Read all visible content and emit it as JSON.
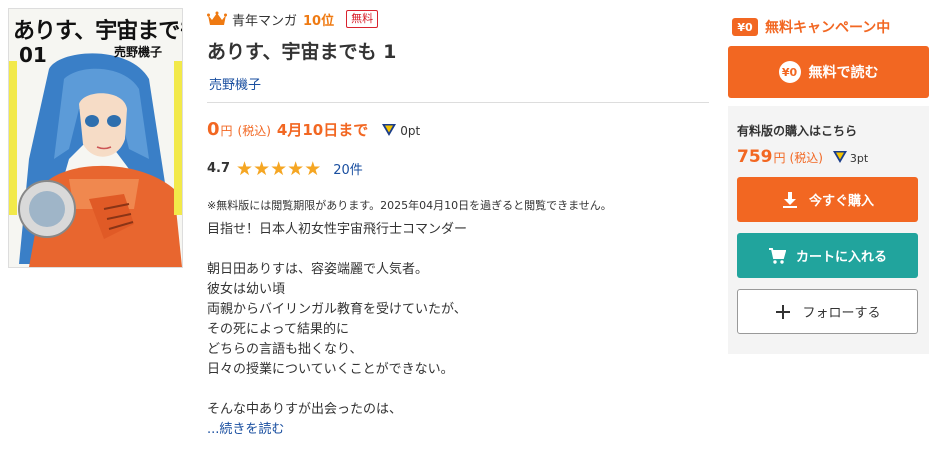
{
  "cover": {
    "title_text": "ありす、宇宙までも",
    "volume_text": "01",
    "author_text": "売野機子"
  },
  "header": {
    "genre": "青年マンガ",
    "rank": "10位",
    "free_badge": "無料"
  },
  "book": {
    "title": "ありす、宇宙までも 1",
    "author": "売野機子"
  },
  "price": {
    "value": "0",
    "yen": "円",
    "tax": "(税込)",
    "until": "4月10日まで",
    "points": "0pt"
  },
  "rating": {
    "score": "4.7",
    "stars": 4.7,
    "count": "20件"
  },
  "notice": "※無料版には閲覧期限があります。2025年04月10日を過ぎると閲覧できません。",
  "description": [
    "目指せ！日本人初女性宇宙飛行士コマンダー",
    "",
    "朝日田ありすは、容姿端麗で人気者。",
    "彼女は幼い頃",
    "両親からバイリンガル教育を受けていたが、",
    "その死によって結果的に",
    "どちらの言語も拙くなり、",
    "日々の授業についていくことができない。",
    "",
    "そんな中ありすが出会ったのは、"
  ],
  "read_more": "...続きを読む",
  "sidebar": {
    "campaign_icon": "¥0",
    "campaign_text": "無料キャンペーン中",
    "free_button_coin": "¥0",
    "free_button_label": "無料で読む",
    "paid_title": "有料版の購入はこちら",
    "paid_price": "759",
    "paid_yen": "円",
    "paid_tax": "(税込)",
    "paid_points": "3pt",
    "buy_label": "今すぐ購入",
    "cart_label": "カートに入れる",
    "follow_label": "フォローする"
  },
  "colors": {
    "accent": "#f26722",
    "teal": "#21a49d",
    "link": "#1a4fa0",
    "badge_red": "#d9232e",
    "star": "#f5a623"
  },
  "icons": {
    "crown": "crown-icon",
    "points": "v-point-icon",
    "download": "download-icon",
    "cart": "cart-icon",
    "plus": "plus-icon"
  }
}
